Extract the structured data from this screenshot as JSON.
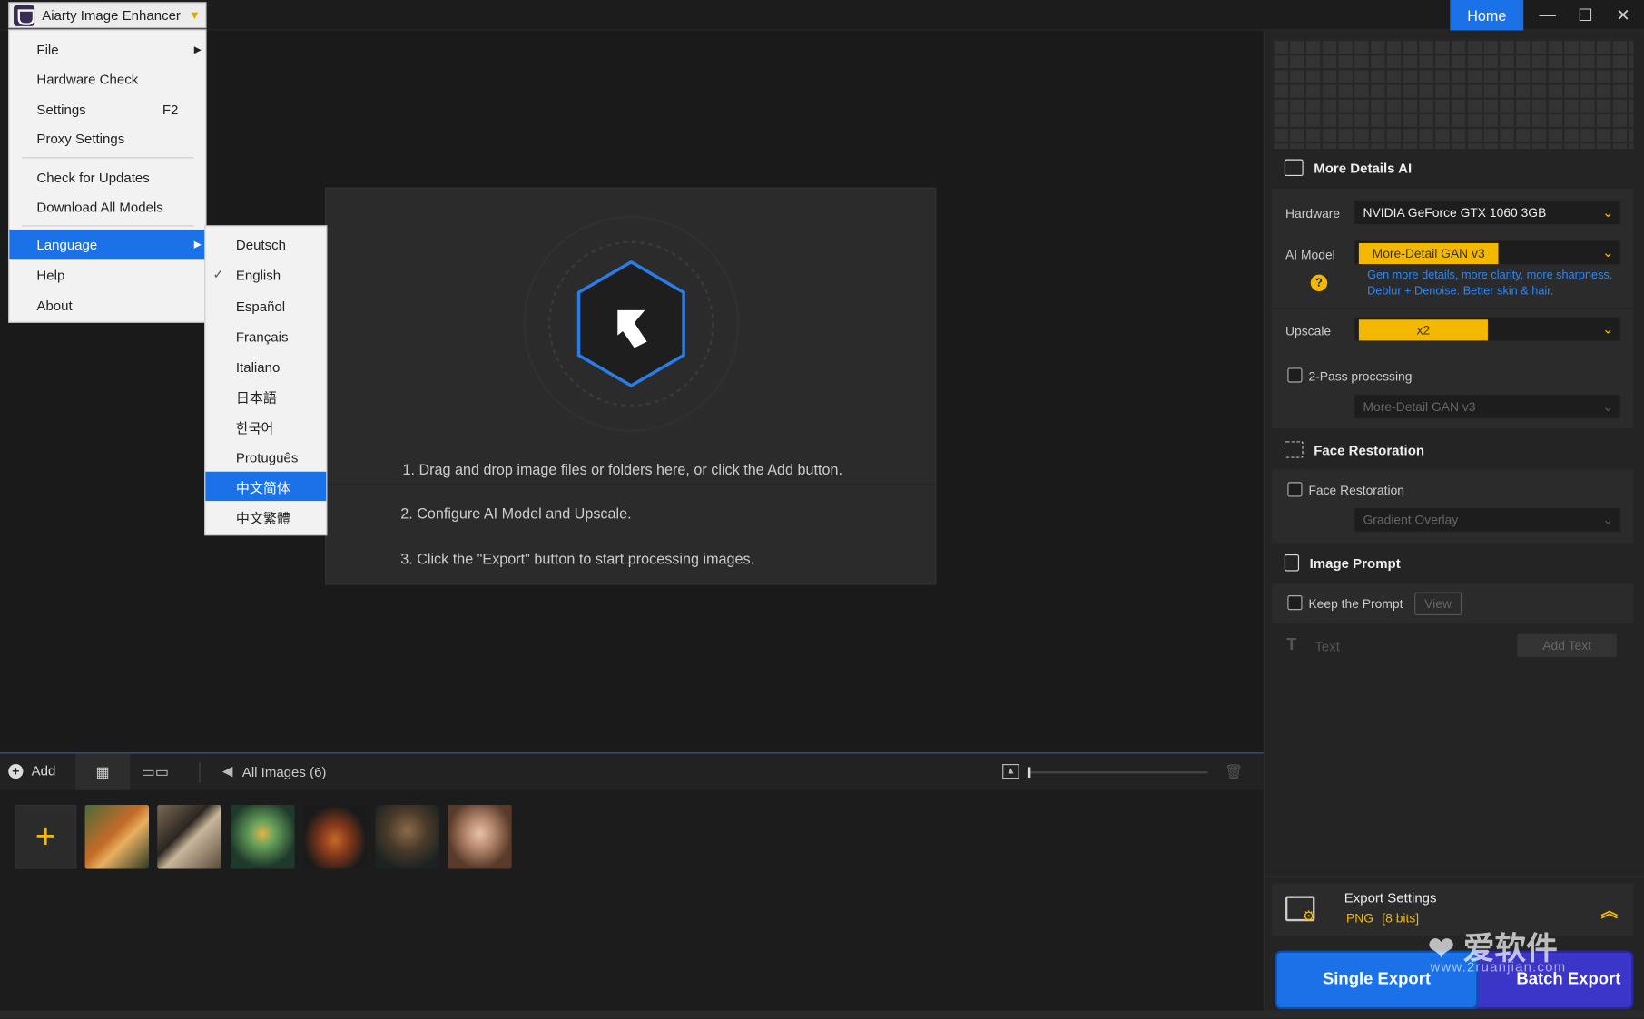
{
  "titlebar": {
    "app_title": "Aiarty Image Enhancer",
    "home": "Home",
    "minimize": "—",
    "maximize": "☐",
    "close": "✕"
  },
  "menu": {
    "items": [
      {
        "label": "File",
        "has_submenu": true
      },
      {
        "label": "Hardware Check"
      },
      {
        "label": "Settings",
        "shortcut": "F2"
      },
      {
        "label": "Proxy Settings"
      },
      {
        "label": "Check for Updates"
      },
      {
        "label": "Download All Models"
      },
      {
        "label": "Language",
        "has_submenu": true,
        "selected": true
      },
      {
        "label": "Help"
      },
      {
        "label": "About"
      }
    ]
  },
  "language_menu": {
    "items": [
      "Deutsch",
      "English",
      "Español",
      "Français",
      "Italiano",
      "日本語",
      "한국어",
      "Protuguês",
      "中文简体",
      "中文繁體"
    ],
    "checked": "English",
    "highlighted": "中文简体"
  },
  "canvas": {
    "steps": [
      "1. Drag and drop image files or folders here, or click the Add button.",
      "2. Configure AI Model and Upscale.",
      "3. Click the \"Export\" button to start processing images."
    ]
  },
  "bottombar": {
    "add": "Add",
    "all_images": "All Images (6)",
    "thumbnail_zoom_percent": 0
  },
  "thumbnails": [
    "tiger",
    "butterfly",
    "forest-jar",
    "burger",
    "dog",
    "portrait"
  ],
  "panel": {
    "more_details": {
      "title": "More Details AI",
      "hardware_label": "Hardware",
      "hardware_value": "NVIDIA GeForce GTX 1060 3GB",
      "model_label": "AI Model",
      "model_value": "More-Detail GAN  v3",
      "model_desc_1": "Gen more details, more clarity, more sharpness.",
      "model_desc_2": "Deblur + Denoise. Better skin & hair.",
      "upscale_label": "Upscale",
      "upscale_value": "x2",
      "two_pass_label": "2-Pass processing",
      "two_pass_model": "More-Detail GAN  v3"
    },
    "face": {
      "title": "Face Restoration",
      "checkbox_label": "Face Restoration",
      "model": "Gradient Overlay"
    },
    "prompt": {
      "title": "Image Prompt",
      "keep_label": "Keep the Prompt",
      "view": "View",
      "text_label": "Text",
      "add_text": "Add Text"
    },
    "export": {
      "title": "Export Settings",
      "format": "PNG",
      "bits": "[8 bits]",
      "single": "Single Export",
      "batch": "Batch Export"
    }
  },
  "watermark": {
    "text": "爱软件",
    "url": "www.2ruanjian.com"
  },
  "colors": {
    "accent_blue": "#1b72e8",
    "accent_yellow": "#f5b800",
    "batch_purple": "#3b36c8"
  }
}
